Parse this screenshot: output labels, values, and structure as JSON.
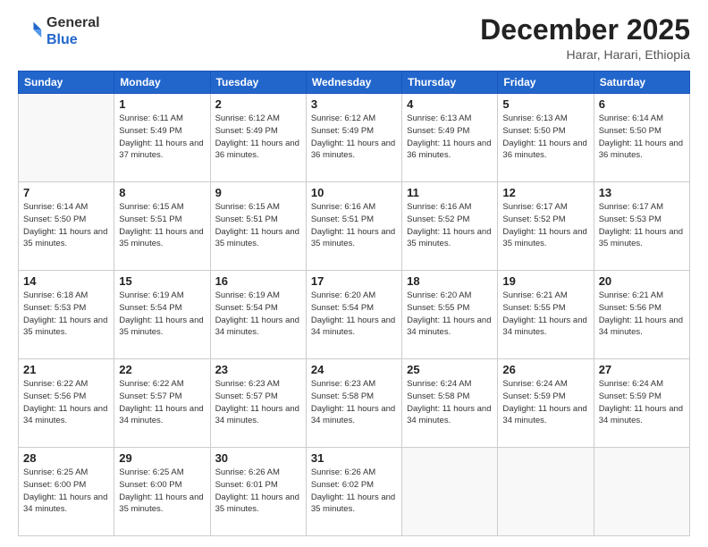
{
  "logo": {
    "general": "General",
    "blue": "Blue"
  },
  "header": {
    "month": "December 2025",
    "location": "Harar, Harari, Ethiopia"
  },
  "weekdays": [
    "Sunday",
    "Monday",
    "Tuesday",
    "Wednesday",
    "Thursday",
    "Friday",
    "Saturday"
  ],
  "weeks": [
    [
      {
        "day": "",
        "info": ""
      },
      {
        "day": "1",
        "info": "Sunrise: 6:11 AM\nSunset: 5:49 PM\nDaylight: 11 hours\nand 37 minutes."
      },
      {
        "day": "2",
        "info": "Sunrise: 6:12 AM\nSunset: 5:49 PM\nDaylight: 11 hours\nand 36 minutes."
      },
      {
        "day": "3",
        "info": "Sunrise: 6:12 AM\nSunset: 5:49 PM\nDaylight: 11 hours\nand 36 minutes."
      },
      {
        "day": "4",
        "info": "Sunrise: 6:13 AM\nSunset: 5:49 PM\nDaylight: 11 hours\nand 36 minutes."
      },
      {
        "day": "5",
        "info": "Sunrise: 6:13 AM\nSunset: 5:50 PM\nDaylight: 11 hours\nand 36 minutes."
      },
      {
        "day": "6",
        "info": "Sunrise: 6:14 AM\nSunset: 5:50 PM\nDaylight: 11 hours\nand 36 minutes."
      }
    ],
    [
      {
        "day": "7",
        "info": "Sunrise: 6:14 AM\nSunset: 5:50 PM\nDaylight: 11 hours\nand 35 minutes."
      },
      {
        "day": "8",
        "info": "Sunrise: 6:15 AM\nSunset: 5:51 PM\nDaylight: 11 hours\nand 35 minutes."
      },
      {
        "day": "9",
        "info": "Sunrise: 6:15 AM\nSunset: 5:51 PM\nDaylight: 11 hours\nand 35 minutes."
      },
      {
        "day": "10",
        "info": "Sunrise: 6:16 AM\nSunset: 5:51 PM\nDaylight: 11 hours\nand 35 minutes."
      },
      {
        "day": "11",
        "info": "Sunrise: 6:16 AM\nSunset: 5:52 PM\nDaylight: 11 hours\nand 35 minutes."
      },
      {
        "day": "12",
        "info": "Sunrise: 6:17 AM\nSunset: 5:52 PM\nDaylight: 11 hours\nand 35 minutes."
      },
      {
        "day": "13",
        "info": "Sunrise: 6:17 AM\nSunset: 5:53 PM\nDaylight: 11 hours\nand 35 minutes."
      }
    ],
    [
      {
        "day": "14",
        "info": "Sunrise: 6:18 AM\nSunset: 5:53 PM\nDaylight: 11 hours\nand 35 minutes."
      },
      {
        "day": "15",
        "info": "Sunrise: 6:19 AM\nSunset: 5:54 PM\nDaylight: 11 hours\nand 35 minutes."
      },
      {
        "day": "16",
        "info": "Sunrise: 6:19 AM\nSunset: 5:54 PM\nDaylight: 11 hours\nand 34 minutes."
      },
      {
        "day": "17",
        "info": "Sunrise: 6:20 AM\nSunset: 5:54 PM\nDaylight: 11 hours\nand 34 minutes."
      },
      {
        "day": "18",
        "info": "Sunrise: 6:20 AM\nSunset: 5:55 PM\nDaylight: 11 hours\nand 34 minutes."
      },
      {
        "day": "19",
        "info": "Sunrise: 6:21 AM\nSunset: 5:55 PM\nDaylight: 11 hours\nand 34 minutes."
      },
      {
        "day": "20",
        "info": "Sunrise: 6:21 AM\nSunset: 5:56 PM\nDaylight: 11 hours\nand 34 minutes."
      }
    ],
    [
      {
        "day": "21",
        "info": "Sunrise: 6:22 AM\nSunset: 5:56 PM\nDaylight: 11 hours\nand 34 minutes."
      },
      {
        "day": "22",
        "info": "Sunrise: 6:22 AM\nSunset: 5:57 PM\nDaylight: 11 hours\nand 34 minutes."
      },
      {
        "day": "23",
        "info": "Sunrise: 6:23 AM\nSunset: 5:57 PM\nDaylight: 11 hours\nand 34 minutes."
      },
      {
        "day": "24",
        "info": "Sunrise: 6:23 AM\nSunset: 5:58 PM\nDaylight: 11 hours\nand 34 minutes."
      },
      {
        "day": "25",
        "info": "Sunrise: 6:24 AM\nSunset: 5:58 PM\nDaylight: 11 hours\nand 34 minutes."
      },
      {
        "day": "26",
        "info": "Sunrise: 6:24 AM\nSunset: 5:59 PM\nDaylight: 11 hours\nand 34 minutes."
      },
      {
        "day": "27",
        "info": "Sunrise: 6:24 AM\nSunset: 5:59 PM\nDaylight: 11 hours\nand 34 minutes."
      }
    ],
    [
      {
        "day": "28",
        "info": "Sunrise: 6:25 AM\nSunset: 6:00 PM\nDaylight: 11 hours\nand 34 minutes."
      },
      {
        "day": "29",
        "info": "Sunrise: 6:25 AM\nSunset: 6:00 PM\nDaylight: 11 hours\nand 35 minutes."
      },
      {
        "day": "30",
        "info": "Sunrise: 6:26 AM\nSunset: 6:01 PM\nDaylight: 11 hours\nand 35 minutes."
      },
      {
        "day": "31",
        "info": "Sunrise: 6:26 AM\nSunset: 6:02 PM\nDaylight: 11 hours\nand 35 minutes."
      },
      {
        "day": "",
        "info": ""
      },
      {
        "day": "",
        "info": ""
      },
      {
        "day": "",
        "info": ""
      }
    ]
  ]
}
